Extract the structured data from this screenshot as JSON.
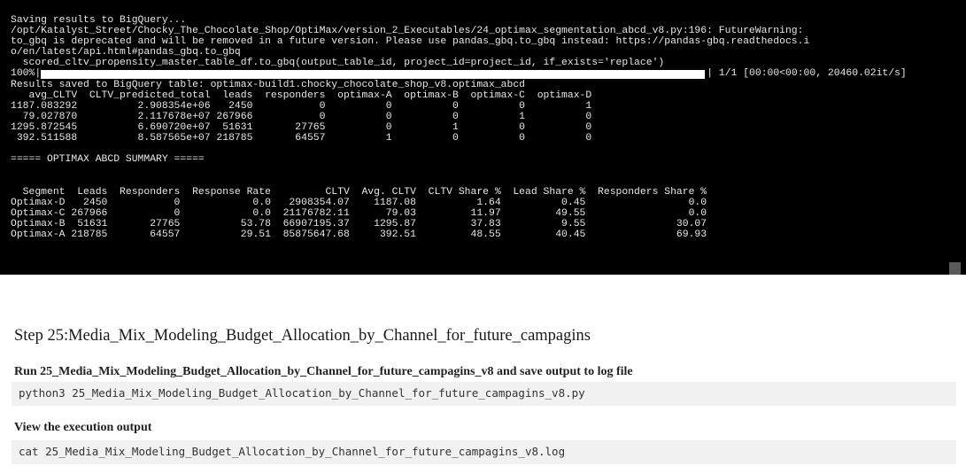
{
  "terminal": {
    "lines": [
      "Saving results to BigQuery...",
      "/opt/Katalyst_Street/Chocky_The_Chocolate_Shop/OptiMax/version_2_Executables/24_optimax_segmentation_abcd_v8.py:196: FutureWarning:",
      "to_gbq is deprecated and will be removed in a future version. Please use pandas_gbq.to_gbq instead: https://pandas-gbq.readthedocs.i",
      "o/en/latest/api.html#pandas_gbq.to_gbq",
      "  scored_cltv_propensity_master_table_df.to_gbq(output_table_id, project_id=project_id, if_exists='replace')"
    ],
    "progress": {
      "percent_label": "100%|",
      "fraction": 1.0,
      "suffix": "| 1/1 [00:00<00:00, 20460.02it/s]"
    },
    "lines_after": [
      "Results saved to BigQuery table: optimax-build1.chocky_chocolate_shop_v8.optimax_abcd",
      "   avg_CLTV  CLTV_predicted_total  leads  responders  optimax-A  optimax-B  optimax-C  optimax-D",
      "1187.083292          2.908354e+06   2450           0          0          0          0          1",
      "  79.027870          2.117678e+07 267966           0          0          0          1          0",
      "1295.872545          6.690720e+07  51631       27765          0          1          0          0",
      " 392.511588          8.587565e+07 218785       64557          1          0          0          0",
      "",
      "===== OPTIMAX ABCD SUMMARY =====",
      "",
      "",
      "  Segment  Leads  Responders  Response Rate         CLTV  Avg. CLTV  CLTV Share %  Lead Share %  Responders Share %",
      "Optimax-D   2450           0            0.0   2908354.07    1187.08          1.64          0.45                 0.0",
      "Optimax-C 267966           0            0.0  21176782.11      79.03         11.97         49.55                 0.0",
      "Optimax-B  51631       27765          53.78  66907195.37    1295.87         37.83          9.55               30.07",
      "Optimax-A 218785       64557          29.51  85875647.68     392.51         48.55         40.45               69.93"
    ]
  },
  "step": {
    "heading": "Step 25:Media_Mix_Modeling_Budget_Allocation_by_Channel_for_future_campagins",
    "run_label": "Run 25_Media_Mix_Modeling_Budget_Allocation_by_Channel_for_future_campagins_v8 and save output to log file",
    "run_command": "python3 25_Media_Mix_Modeling_Budget_Allocation_by_Channel_for_future_campagins_v8.py",
    "view_label": "View the execution output",
    "view_command": "cat 25_Media_Mix_Modeling_Budget_Allocation_by_Channel_for_future_campagins_v8.log"
  }
}
